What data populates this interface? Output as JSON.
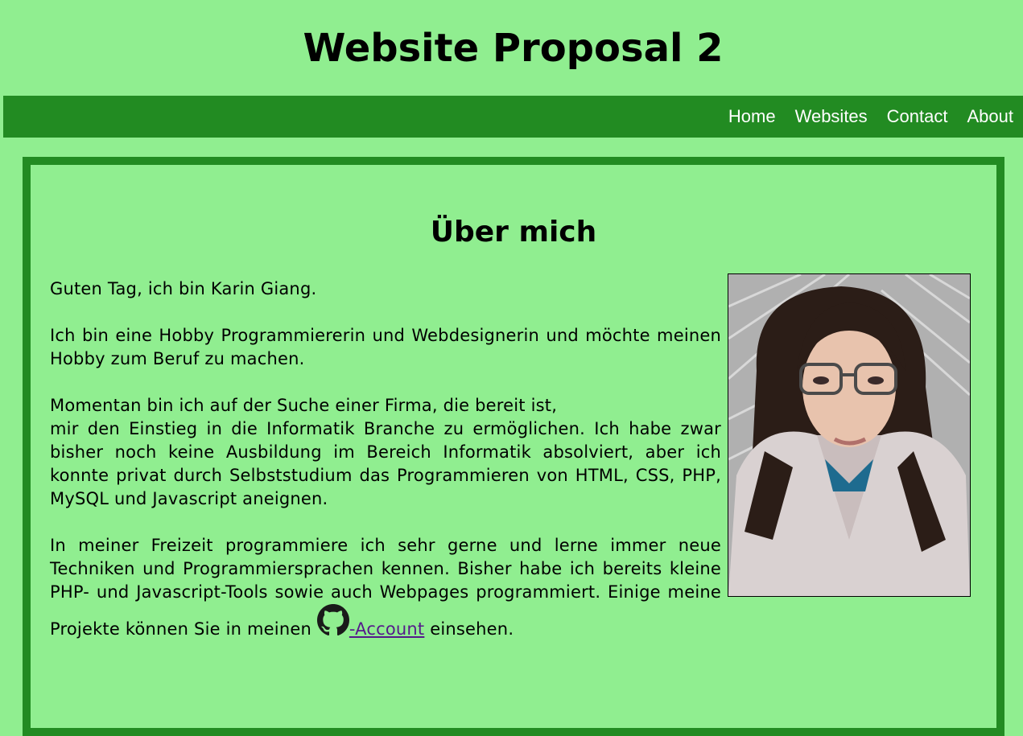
{
  "header": {
    "title": "Website Proposal 2"
  },
  "nav": {
    "items": [
      {
        "label": "Home"
      },
      {
        "label": "Websites"
      },
      {
        "label": "Contact"
      },
      {
        "label": "About"
      }
    ]
  },
  "about": {
    "heading": "Über mich",
    "greeting": "Guten Tag, ich bin Karin Giang.",
    "paragraph_hobby": "Ich bin eine Hobby Programmiererin und Webdesignerin und möchte meinen Hobby zum Beruf zu machen.",
    "paragraph_search_line1": "Momentan bin ich auf der Suche einer Firma, die bereit ist,",
    "paragraph_search_rest": "mir den Einstieg in die Informatik Branche zu ermöglichen. Ich habe zwar bisher noch keine Ausbildung im Bereich Informatik absolviert, aber ich konnte privat durch Selbststudium das Programmieren von HTML, CSS, PHP, MySQL und Javascript aneignen.",
    "paragraph_free_time": "In meiner Freizeit programmiere ich sehr gerne und lerne immer neue Techniken und Programmiersprachen kennen. Bisher habe ich bereits kleine PHP- und Javascript-Tools sowie auch Webpages programmiert. Einige meine Projekte können Sie in meinen ",
    "github_link_text": "-Account",
    "paragraph_free_time_end": " einsehen.",
    "github_icon": "github-icon",
    "photo_icon": "profile-photo"
  },
  "colors": {
    "background": "#90ee90",
    "accent": "#228b22",
    "nav_text": "#ffffff",
    "link": "#551a8b"
  }
}
